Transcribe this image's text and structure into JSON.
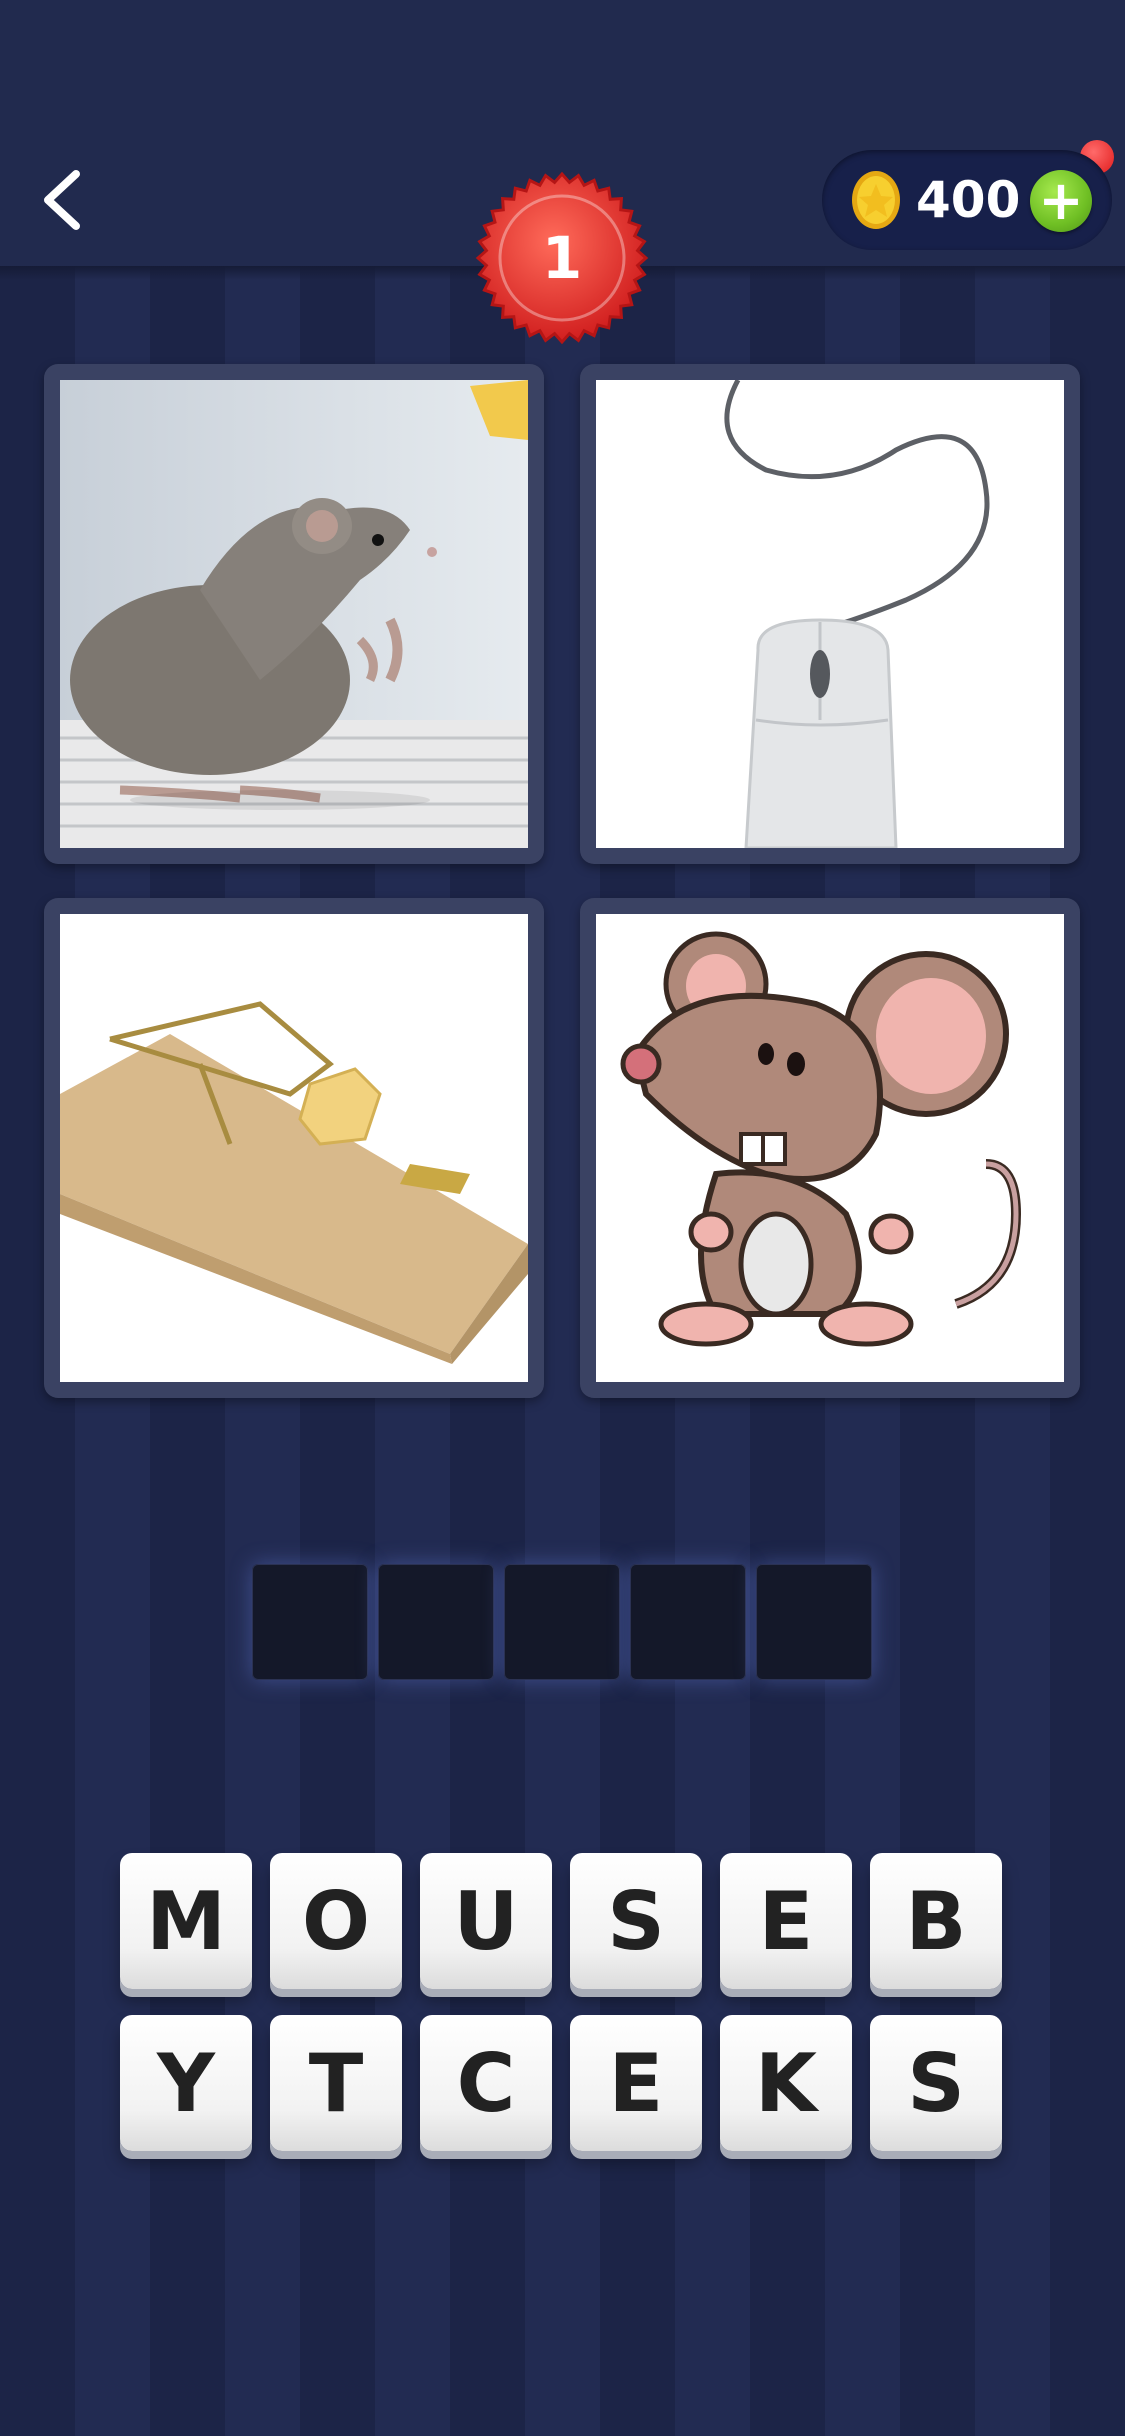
{
  "header": {
    "level": "1",
    "coins": "400",
    "add_label": "+"
  },
  "clue_images": [
    {
      "name": "mouse-photo"
    },
    {
      "name": "computer-mouse"
    },
    {
      "name": "mouse-trap"
    },
    {
      "name": "cartoon-mouse"
    }
  ],
  "answer": {
    "slots": 5
  },
  "letters": {
    "row1": [
      "M",
      "O",
      "U",
      "S",
      "E",
      "B"
    ],
    "row2": [
      "Y",
      "T",
      "C",
      "E",
      "K",
      "S"
    ]
  }
}
